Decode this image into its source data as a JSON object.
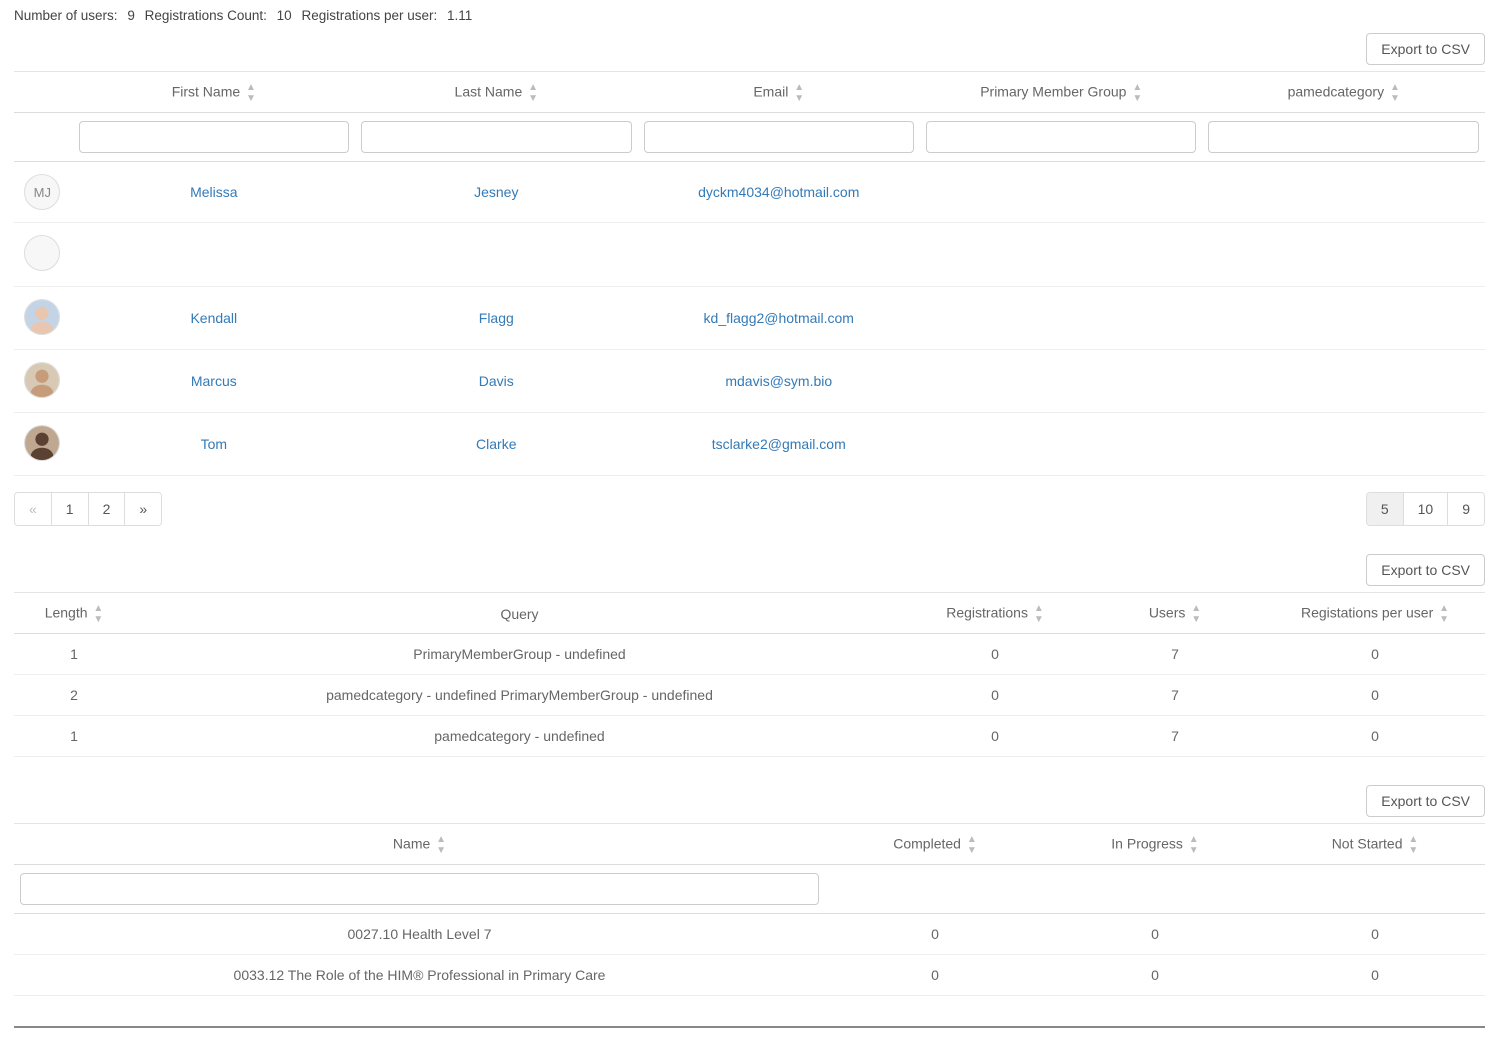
{
  "stats": {
    "num_users_label": "Number of users:",
    "num_users": "9",
    "reg_count_label": "Registrations Count:",
    "reg_count": "10",
    "reg_per_user_label": "Registrations per user:",
    "reg_per_user": "1.11"
  },
  "buttons": {
    "export_csv": "Export to CSV"
  },
  "users_table": {
    "headers": {
      "first_name": "First Name",
      "last_name": "Last Name",
      "email": "Email",
      "primary_member_group": "Primary Member Group",
      "pamedcategory": "pamedcategory"
    },
    "rows": [
      {
        "initials": "MJ",
        "avatar_type": "initials",
        "first_name": "Melissa",
        "last_name": "Jesney",
        "email": "dyckm4034@hotmail.com",
        "primary_member_group": "",
        "pamedcategory": ""
      },
      {
        "initials": "",
        "avatar_type": "blank",
        "first_name": "",
        "last_name": "",
        "email": "",
        "primary_member_group": "",
        "pamedcategory": ""
      },
      {
        "initials": "",
        "avatar_type": "photo1",
        "first_name": "Kendall",
        "last_name": "Flagg",
        "email": "kd_flagg2@hotmail.com",
        "primary_member_group": "",
        "pamedcategory": ""
      },
      {
        "initials": "",
        "avatar_type": "photo2",
        "first_name": "Marcus",
        "last_name": "Davis",
        "email": "mdavis@sym.bio",
        "primary_member_group": "",
        "pamedcategory": ""
      },
      {
        "initials": "",
        "avatar_type": "photo3",
        "first_name": "Tom",
        "last_name": "Clarke",
        "email": "tsclarke2@gmail.com",
        "primary_member_group": "",
        "pamedcategory": ""
      }
    ]
  },
  "pagination": {
    "prev": "«",
    "next": "»",
    "pages": [
      "1",
      "2"
    ],
    "active_page": "2",
    "sizes": [
      "5",
      "10",
      "9"
    ],
    "active_size": "5"
  },
  "query_table": {
    "headers": {
      "length": "Length",
      "query": "Query",
      "registrations": "Registrations",
      "users": "Users",
      "reg_per_user": "Registations per user"
    },
    "rows": [
      {
        "length": "1",
        "query": "PrimaryMemberGroup - undefined",
        "registrations": "0",
        "users": "7",
        "reg_per_user": "0"
      },
      {
        "length": "2",
        "query": "pamedcategory - undefined PrimaryMemberGroup - undefined",
        "registrations": "0",
        "users": "7",
        "reg_per_user": "0"
      },
      {
        "length": "1",
        "query": "pamedcategory - undefined",
        "registrations": "0",
        "users": "7",
        "reg_per_user": "0"
      }
    ]
  },
  "progress_table": {
    "headers": {
      "name": "Name",
      "completed": "Completed",
      "in_progress": "In Progress",
      "not_started": "Not Started"
    },
    "rows": [
      {
        "name": "0027.10 Health Level 7",
        "completed": "0",
        "in_progress": "0",
        "not_started": "0"
      },
      {
        "name": "0033.12 The Role of the HIM® Professional in Primary Care",
        "completed": "0",
        "in_progress": "0",
        "not_started": "0"
      }
    ]
  }
}
